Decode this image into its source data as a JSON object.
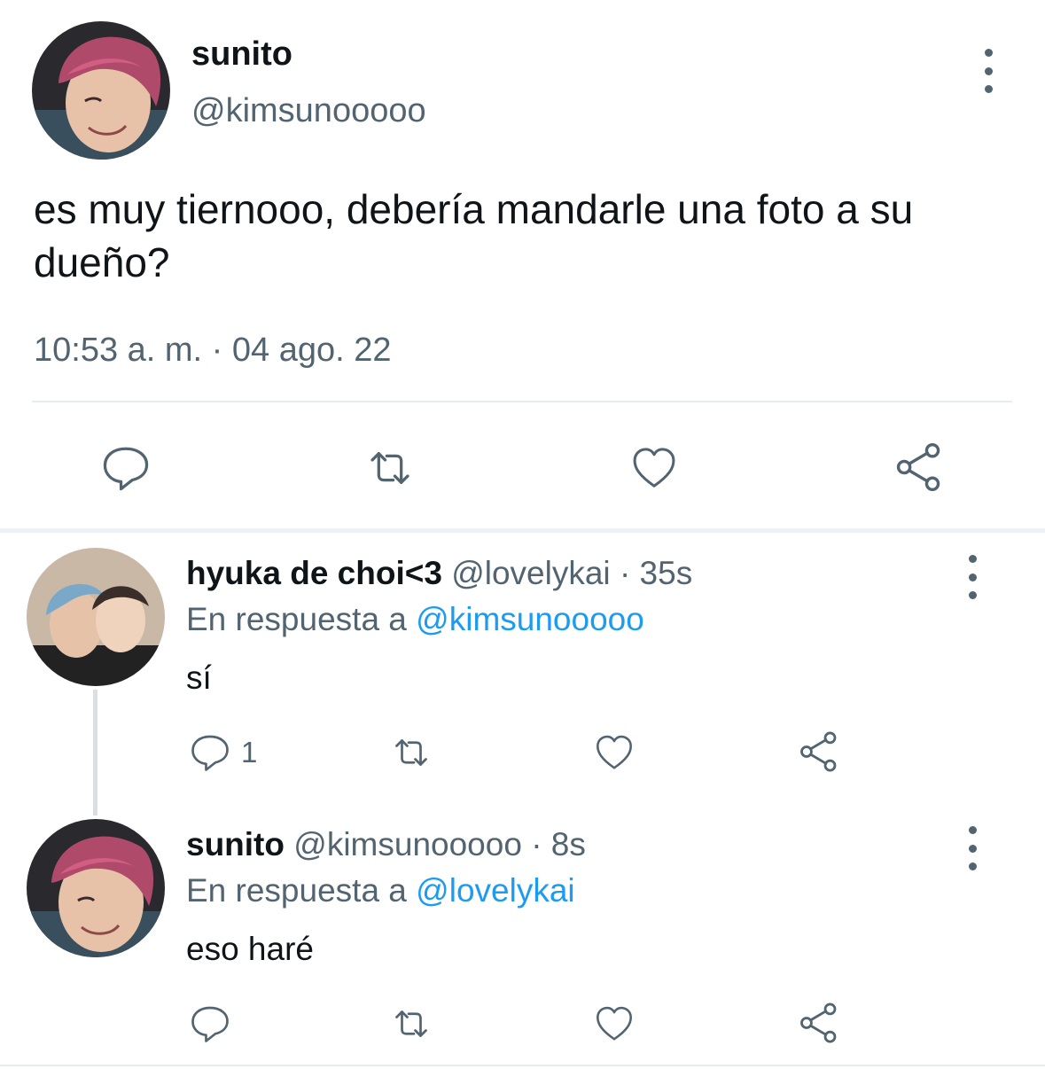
{
  "main_tweet": {
    "display_name": "sunito",
    "handle": "@kimsunooooo",
    "text": "es muy tiernooo, debería mandarle una foto a su dueño?",
    "timestamp": "10:53 a. m. · 04 ago. 22",
    "actions": [
      "reply-icon",
      "retweet-icon",
      "like-icon",
      "share-icon"
    ]
  },
  "replies": [
    {
      "display_name": "hyuka de choi<3",
      "handle": "@lovelykai",
      "time": "· 35s",
      "in_reply_prefix": "En respuesta a",
      "in_reply_mention": "@kimsunooooo",
      "text": "sí",
      "reply_count": "1"
    },
    {
      "display_name": "sunito",
      "handle": "@kimsunooooo",
      "time": "· 8s",
      "in_reply_prefix": "En respuesta a",
      "in_reply_mention": "@lovelykai",
      "text": "eso haré",
      "reply_count": ""
    }
  ],
  "colors": {
    "text": "#0f1419",
    "secondary": "#536471",
    "link": "#1d9bf0",
    "divider": "#e6ecf0"
  }
}
